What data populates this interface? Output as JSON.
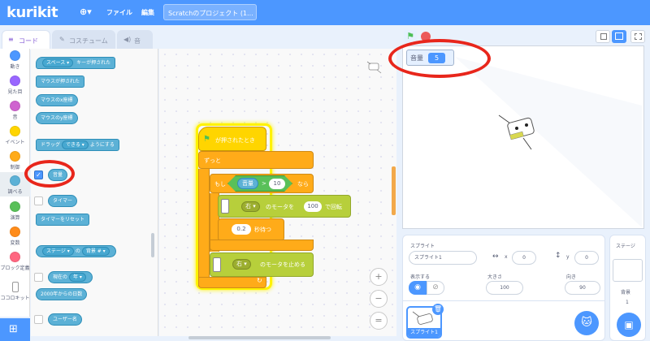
{
  "menubar": {
    "logo": "kurikit",
    "globe": "⊕▾",
    "file": "ファイル",
    "edit": "編集",
    "project_title": "Scratchのプロジェクト (1..."
  },
  "tabs": {
    "code": "コード",
    "costume": "コスチューム",
    "sound": "音"
  },
  "categories": [
    {
      "label": "動き",
      "color": "#4c97ff"
    },
    {
      "label": "見た目",
      "color": "#9966ff"
    },
    {
      "label": "音",
      "color": "#cf63cf"
    },
    {
      "label": "イベント",
      "color": "#ffd500"
    },
    {
      "label": "制御",
      "color": "#ffab19"
    },
    {
      "label": "調べる",
      "color": "#5cb1d6"
    },
    {
      "label": "演算",
      "color": "#59c059"
    },
    {
      "label": "変数",
      "color": "#ff8c1a"
    },
    {
      "label": "ブロック定義",
      "color": "#ff6680"
    },
    {
      "label": "ココロキット",
      "color": "#ffffff"
    }
  ],
  "palette": {
    "key_pressed_key": "スペース ▾",
    "key_pressed_rest": "キーが押された",
    "mouse_down": "マウスが押された",
    "mouse_x": "マウスのx座標",
    "mouse_y": "マウスのy座標",
    "drag_a": "ドラッグ",
    "drag_mode": "できる ▾",
    "drag_b": "ようにする",
    "loudness": "音量",
    "timer": "タイマー",
    "reset_timer": "タイマーをリセット",
    "of_target": "ステージ ▾",
    "of_text": "の",
    "of_prop": "背景 # ▾",
    "current_a": "現在の",
    "current_unit": "年 ▾",
    "days_since": "2000年からの日数",
    "username": "ユーザー名"
  },
  "script": {
    "when_flag": "が押されたとき",
    "forever": "ずっと",
    "if": "もし",
    "then": "なら",
    "cond_var": "音量",
    "cond_op": ">",
    "cond_val": "10",
    "motor1_dir": "右 ▾",
    "motor1_text": "のモータを",
    "motor1_speed": "100",
    "motor1_rot": "で回転",
    "wait_val": "0.2",
    "wait_text": "秒待つ",
    "motor2_dir": "右 ▾",
    "motor2_text": "のモータを止める"
  },
  "zoom": {
    "in": "+",
    "out": "−",
    "reset": "="
  },
  "monitor": {
    "label": "音量",
    "value": "5"
  },
  "sprite_pane": {
    "sprite_label": "スプライト",
    "sprite_name": "スプライト1",
    "x_label": "x",
    "x_value": "0",
    "y_label": "y",
    "y_value": "0",
    "show_label": "表示する",
    "size_label": "大きさ",
    "size_value": "100",
    "direction_label": "向き",
    "direction_value": "90",
    "thumb_name": "スプライト1"
  },
  "stage_pane": {
    "title": "ステージ",
    "backdrop_label": "背景",
    "backdrop_count": "1"
  }
}
